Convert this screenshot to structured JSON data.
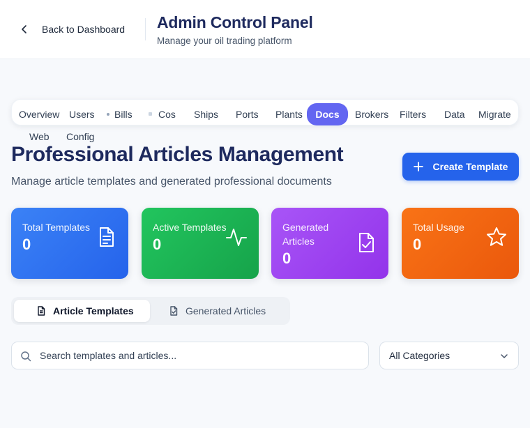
{
  "header": {
    "back_label": "Back to Dashboard",
    "title": "Admin Control Panel",
    "subtitle": "Manage your oil trading platform"
  },
  "nav": {
    "items": [
      "Overview",
      "Users",
      "Bills",
      "Cos",
      "Ships",
      "Ports",
      "Plants",
      "Docs",
      "Brokers",
      "Filters",
      "Data",
      "Migrate",
      "Web",
      "Config"
    ],
    "active": "Docs"
  },
  "page": {
    "title": "Professional Articles Management",
    "subtitle": "Manage article templates and generated professional documents",
    "create_button": "Create Template"
  },
  "stats": [
    {
      "label": "Total Templates",
      "value": "0",
      "icon": "document-icon",
      "color": "#3b82f6"
    },
    {
      "label": "Active Templates",
      "value": "0",
      "icon": "activity-icon",
      "color": "#22c55e"
    },
    {
      "label": "Generated Articles",
      "value": "0",
      "icon": "file-check-icon",
      "color": "#a855f7"
    },
    {
      "label": "Total Usage",
      "value": "0",
      "icon": "star-icon",
      "color": "#f97316"
    }
  ],
  "tabs": [
    {
      "label": "Article Templates",
      "icon": "document-icon",
      "active": true
    },
    {
      "label": "Generated Articles",
      "icon": "file-check-icon",
      "active": false
    }
  ],
  "search": {
    "placeholder": "Search templates and articles...",
    "value": ""
  },
  "category_filter": {
    "selected": "All Categories"
  },
  "colors": {
    "accent": "#2563eb",
    "active_nav": "#6366f1",
    "title": "#1e2a5e"
  }
}
